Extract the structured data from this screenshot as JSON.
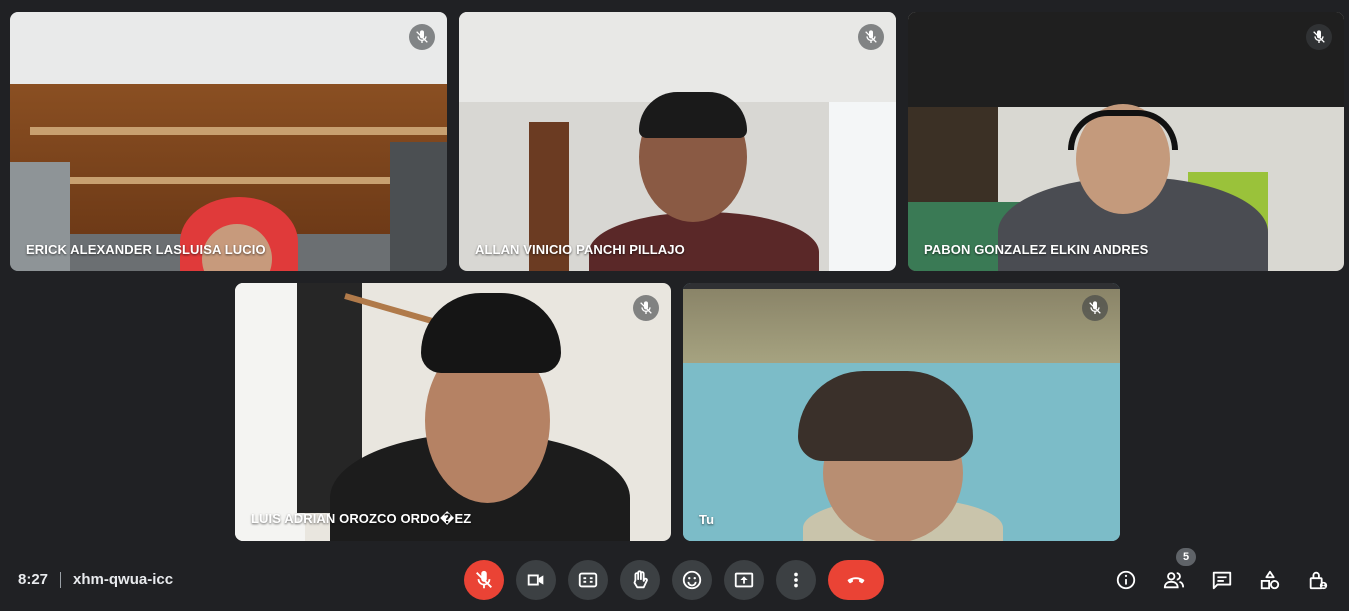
{
  "participants": [
    {
      "name": "ERICK ALEXANDER LASLUISA LUCIO",
      "muted": true
    },
    {
      "name": "ALLAN VINICIO PANCHI PILLAJO",
      "muted": true
    },
    {
      "name": "PABON GONZALEZ ELKIN ANDRES",
      "muted": true
    },
    {
      "name": "LUIS ADRIAN OROZCO ORDO�EZ",
      "muted": true
    },
    {
      "name": "Tu",
      "muted": true
    }
  ],
  "meeting": {
    "time": "8:27",
    "code": "xhm-qwua-icc"
  },
  "controls": {
    "mic": "mic-off-icon",
    "camera": "videocam-icon",
    "captions": "closed-captions-icon",
    "hand": "raise-hand-icon",
    "reactions": "emoji-icon",
    "present": "present-screen-icon",
    "more": "more-vert-icon",
    "hangup": "call-end-icon"
  },
  "side": {
    "people_count": "5"
  },
  "colors": {
    "background": "#202124",
    "danger": "#ea4335",
    "button": "#3c4043"
  }
}
